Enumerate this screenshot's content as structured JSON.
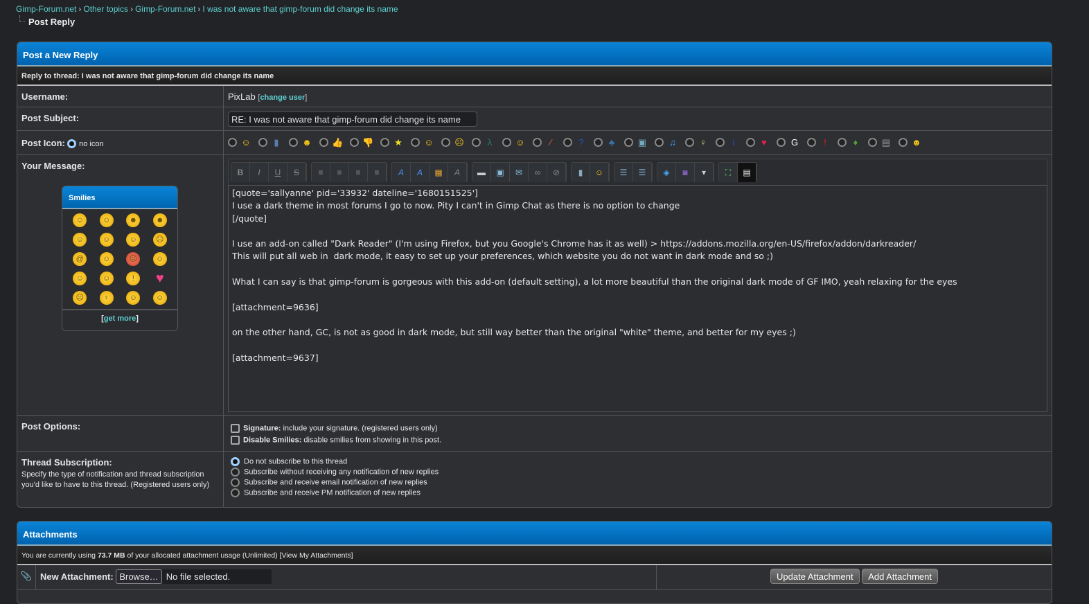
{
  "breadcrumb": [
    "Gimp-Forum.net",
    "Other topics",
    "Gimp-Forum.net",
    "I was not aware that gimp-forum did change its name"
  ],
  "page_title": "Post Reply",
  "form": {
    "header": "Post a New Reply",
    "thread_line": "Reply to thread: I was not aware that gimp-forum did change its name",
    "username_label": "Username:",
    "username": "PixLab",
    "change_user": "change user",
    "subject_label": "Post Subject:",
    "subject": "RE: I was not aware that gimp-forum did change its name",
    "icon_label": "Post Icon:",
    "no_icon": "no icon",
    "post_icons": [
      [
        "smile",
        "#f5c518",
        "☺"
      ],
      [
        "film",
        "#5a7db0",
        "▮"
      ],
      [
        "tongue",
        "#f5c518",
        "☻"
      ],
      [
        "thumbs-up",
        "#e8b080",
        "👍"
      ],
      [
        "thumbs-down",
        "#e8a040",
        "👎"
      ],
      [
        "star",
        "#f0e020",
        "★"
      ],
      [
        "happy",
        "#f5c518",
        "☺"
      ],
      [
        "shocked",
        "#f5c518",
        "☹"
      ],
      [
        "lambda",
        "#2a7a6a",
        "λ"
      ],
      [
        "smile-2",
        "#f5c518",
        "☺"
      ],
      [
        "rainbow",
        "#e06040",
        "⁄"
      ],
      [
        "question",
        "#2255cc",
        "?"
      ],
      [
        "python",
        "#3a74a8",
        "♣"
      ],
      [
        "image",
        "#7ab",
        "▣"
      ],
      [
        "music",
        "#3aa0ff",
        "♫"
      ],
      [
        "lightbulb",
        "#ddd070",
        "♀"
      ],
      [
        "info",
        "#2255cc",
        "i"
      ],
      [
        "heart",
        "#e0204a",
        "♥"
      ],
      [
        "google",
        "#ffffff",
        "G"
      ],
      [
        "exclamation",
        "#e02020",
        "!"
      ],
      [
        "pepper",
        "#50a040",
        "♦"
      ],
      [
        "clapper",
        "#999",
        "▤"
      ],
      [
        "grin",
        "#f5c518",
        "☻"
      ]
    ],
    "message_label": "Your Message:",
    "smilies_title": "Smilies",
    "smilies_more": "get more",
    "message_lines": [
      "[quote='sallyanne' pid='33932' dateline='1680151525']",
      "I use a dark theme in most forums I go to now. Pity I can't in Gimp Chat as there is no option to change",
      "[/quote]",
      "",
      "I use an add-on called \"Dark Reader\" (I'm using Firefox, but you Google's Chrome has it as well) > https://addons.mozilla.org/en-US/firefox/addon/darkreader/",
      "This will put all web in  dark mode, it easy to set up your preferences, which website you do not want in dark mode and so ;)",
      "",
      "What I can say is that gimp-forum is gorgeous with this add-on (default setting), a lot more beautiful than the original dark mode of GF IMO, yeah relaxing for the eyes",
      "",
      "[attachment=9636]",
      "",
      "on the other hand, GC, is not as good in dark mode, but still way better than the original \"white\" theme, and better for my eyes ;)",
      "",
      "[attachment=9637]"
    ],
    "options_label": "Post Options:",
    "signature_b": "Signature:",
    "signature_t": " include your signature. (registered users only)",
    "disable_b": "Disable Smilies:",
    "disable_t": " disable smilies from showing in this post.",
    "subscription_label": "Thread Subscription:",
    "subscription_desc": "Specify the type of notification and thread subscription you'd like to have to this thread. (Registered users only)",
    "subscription_options": [
      "Do not subscribe to this thread",
      "Subscribe without receiving any notification of new replies",
      "Subscribe and receive email notification of new replies",
      "Subscribe and receive PM notification of new replies"
    ]
  },
  "attachments": {
    "header": "Attachments",
    "usage_pre": "You are currently using ",
    "usage_amount": "73.7 MB",
    "usage_post": " of your allocated attachment usage (Unlimited) [View My Attachments]",
    "new_label": "New Attachment:",
    "browse": "Browse…",
    "no_file": "No file selected.",
    "update": "Update Attachment",
    "add": "Add Attachment"
  }
}
